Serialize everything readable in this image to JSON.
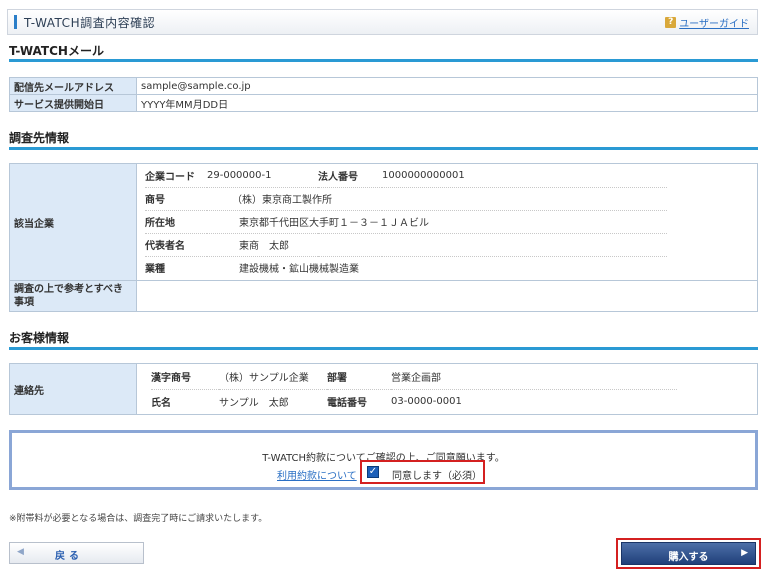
{
  "header": {
    "title": "T-WATCH調査内容確認",
    "guide_icon": "?",
    "guide_link": "ユーザーガイド"
  },
  "sections": {
    "twatch_mail": "T-WATCHメール",
    "investigation": "調査先情報",
    "customer": "お客様情報"
  },
  "mail": {
    "email_label": "配信先メールアドレス",
    "email_value": "sample@sample.co.jp",
    "start_label": "サービス提供開始日",
    "start_value": "YYYY年MM月DD日"
  },
  "company": {
    "label": "該当企業",
    "code_label": "企業コード",
    "code_value": "29-000000-1",
    "corp_no_label": "法人番号",
    "corp_no_value": "1000000000001",
    "name_label": "商号",
    "name_value": "（株）東京商工製作所",
    "address_label": "所在地",
    "address_value": "東京都千代田区大手町１－３－１ＪＡビル",
    "rep_label": "代表者名",
    "rep_value": "東商　太郎",
    "industry_label": "業種",
    "industry_value": "建設機械・鉱山機械製造業",
    "notes_label": "調査の上で参考とすべき事項",
    "notes_value": ""
  },
  "contact": {
    "label": "連絡先",
    "kanji_name_label": "漢字商号",
    "kanji_name_value": "（株）サンプル企業",
    "dept_label": "部署",
    "dept_value": "営業企画部",
    "person_label": "氏名",
    "person_value": "サンプル　太郎",
    "phone_label": "電話番号",
    "phone_value": "03-0000-0001"
  },
  "agreement": {
    "message": "T-WATCH約款についてご確認の上、ご同意願います。",
    "terms_link": "利用約款について",
    "checked": true,
    "agree_label": "同意します（必須）"
  },
  "note": "※附帯料が必要となる場合は、調査完了時にご請求いたします。",
  "buttons": {
    "back_arrow": "◀",
    "back": "戻る",
    "buy": "購入する",
    "buy_arrow": "▶"
  }
}
